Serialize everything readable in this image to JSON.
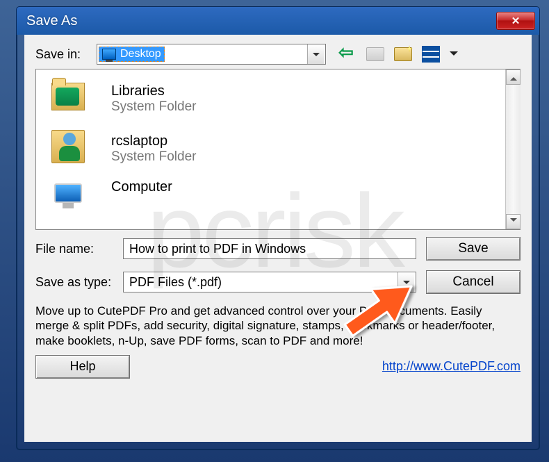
{
  "window": {
    "title": "Save As"
  },
  "savein": {
    "label": "Save in:",
    "selected": "Desktop"
  },
  "items": [
    {
      "name": "Libraries",
      "type": "System Folder"
    },
    {
      "name": "rcslaptop",
      "type": "System Folder"
    },
    {
      "name": "Computer",
      "type": ""
    }
  ],
  "filename": {
    "label": "File name:",
    "value": "How to print to PDF in Windows"
  },
  "saveastype": {
    "label": "Save as type:",
    "value": "PDF Files (*.pdf)"
  },
  "buttons": {
    "save": "Save",
    "cancel": "Cancel",
    "help": "Help"
  },
  "promo": "Move up to CutePDF Pro and get advanced control over your PDF documents. Easily merge & split PDFs, add security, digital signature, stamps, bookmarks or header/footer, make booklets, n-Up, save PDF forms, scan to PDF and more!",
  "link": "http://www.CutePDF.com",
  "watermark": "pcrisk"
}
